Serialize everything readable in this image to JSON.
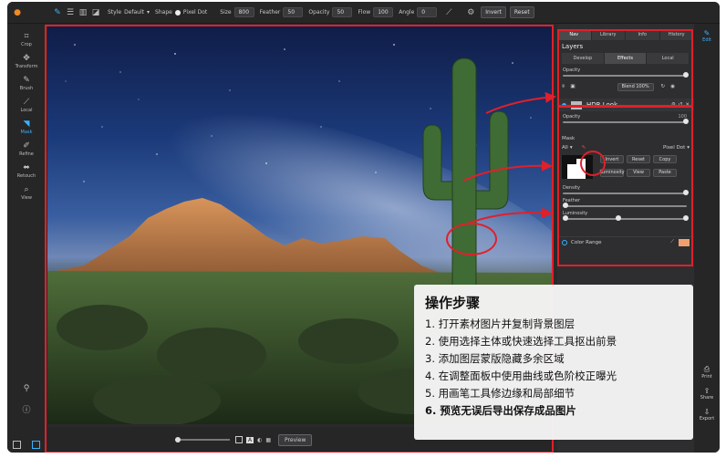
{
  "toolbar": {
    "style_label": "Style",
    "style_value": "Default",
    "shape_label": "Shape",
    "shape_value": "Pixel Dot",
    "size_label": "Size",
    "size_value": "800",
    "feather_label": "Feather",
    "feather_value": "50",
    "opacity_label": "Opacity",
    "opacity_value": "50",
    "flow_label": "Flow",
    "flow_value": "100",
    "angle_label": "Angle",
    "angle_value": "0",
    "invert_label": "Invert",
    "reset_label": "Reset"
  },
  "tools": [
    {
      "icon": "crop-icon",
      "glyph": "⌗",
      "label": "Crop"
    },
    {
      "icon": "transform-icon",
      "glyph": "✥",
      "label": "Transform"
    },
    {
      "icon": "brush-icon",
      "glyph": "✎",
      "label": "Brush"
    },
    {
      "icon": "local-icon",
      "glyph": "⟋",
      "label": "Local"
    },
    {
      "icon": "mask-icon",
      "glyph": "◥",
      "label": "Mask"
    },
    {
      "icon": "refine-icon",
      "glyph": "✐",
      "label": "Refine"
    },
    {
      "icon": "retouch-icon",
      "glyph": "⬌",
      "label": "Retouch"
    },
    {
      "icon": "view-icon",
      "glyph": "⌕",
      "label": "View"
    }
  ],
  "bottom": {
    "preview_label": "Preview",
    "badge_a": "A"
  },
  "right_panel": {
    "tabs": [
      "Nav",
      "Library",
      "Info",
      "History"
    ],
    "layers_title": "Layers",
    "layer_tabs": [
      "Develop",
      "Effects",
      "Local"
    ],
    "opacity_label": "Opacity",
    "opacity_value": "100",
    "blend_value": "Blend 100%",
    "hdr_title": "HDR Look",
    "hdr_opacity_label": "Opacity",
    "hdr_opacity_value": "100",
    "mask_label": "Mask",
    "mask_all": "All",
    "mask_mode": "Pixel Dot",
    "mask_buttons": [
      "Invert",
      "Reset",
      "Copy",
      "Luminosity",
      "View",
      "Paste"
    ],
    "density_label": "Density",
    "feather_label": "Feather",
    "luminosity_label": "Luminosity",
    "color_range_label": "Color Range"
  },
  "right_strip": {
    "top_label": "Edit",
    "items": [
      "Print",
      "Share",
      "Export"
    ]
  },
  "steps": {
    "title": "操作步骤",
    "items": [
      "1. 打开素材图片并复制背景图层",
      "2. 使用选择主体或快速选择工具抠出前景",
      "3. 添加图层蒙版隐藏多余区域",
      "4. 在调整面板中使用曲线或色阶校正曝光",
      "5. 用画笔工具修边缘和局部细节",
      "6. 预览无误后导出保存成品图片"
    ]
  },
  "colors": {
    "accent": "#3ab2ff",
    "annotation": "#e0202a",
    "panel_bg": "#2e2e30"
  }
}
